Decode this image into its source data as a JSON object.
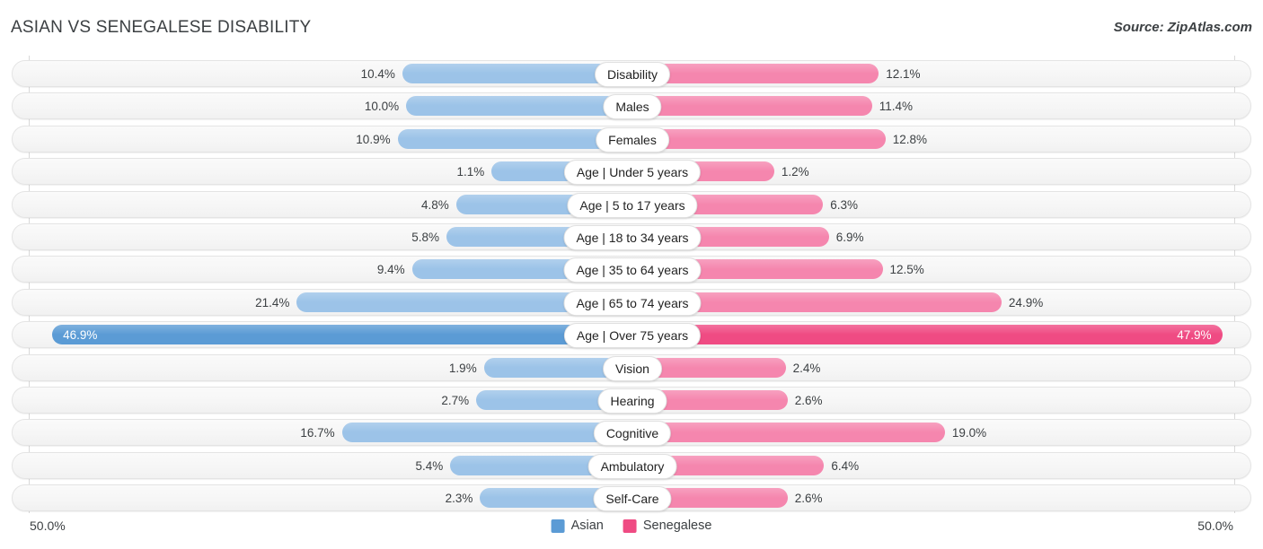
{
  "header": {
    "title": "ASIAN VS SENEGALESE DISABILITY",
    "source": "Source: ZipAtlas.com"
  },
  "footer": {
    "axis_min": "50.0%",
    "axis_max": "50.0%",
    "legend": [
      {
        "label": "Asian",
        "color": "#5b9bd5",
        "swatch": "asian"
      },
      {
        "label": "Senegalese",
        "color": "#ef4b83",
        "swatch": "senegalese"
      }
    ]
  },
  "colors": {
    "asian_bar": "#9cc3e8",
    "senegalese_bar": "#f586ae",
    "asian_bar_emphasis": "#5b9bd5",
    "senegalese_bar_emphasis": "#ef4b83",
    "row_background": "#f6f6f6",
    "text": "#3c4043"
  },
  "chart_data": {
    "type": "bar",
    "title": "ASIAN VS SENEGALESE DISABILITY",
    "orientation": "horizontal-diverging",
    "xlabel": "",
    "ylabel": "",
    "xlim": [
      -50.0,
      50.0
    ],
    "axis_tick_labels": [
      "50.0%",
      "50.0%"
    ],
    "grid": true,
    "legend_position": "bottom-center",
    "units": "percent",
    "categories": [
      "Disability",
      "Males",
      "Females",
      "Age | Under 5 years",
      "Age | 5 to 17 years",
      "Age | 18 to 34 years",
      "Age | 35 to 64 years",
      "Age | 65 to 74 years",
      "Age | Over 75 years",
      "Vision",
      "Hearing",
      "Cognitive",
      "Ambulatory",
      "Self-Care"
    ],
    "series": [
      {
        "name": "Asian",
        "side": "left",
        "color": "#9cc3e8",
        "values": [
          10.4,
          10.0,
          10.9,
          1.1,
          4.8,
          5.8,
          9.4,
          21.4,
          46.9,
          1.9,
          2.7,
          16.7,
          5.4,
          2.3
        ],
        "labels": [
          "10.4%",
          "10.0%",
          "10.9%",
          "1.1%",
          "4.8%",
          "5.8%",
          "9.4%",
          "21.4%",
          "46.9%",
          "1.9%",
          "2.7%",
          "16.7%",
          "5.4%",
          "2.3%"
        ]
      },
      {
        "name": "Senegalese",
        "side": "right",
        "color": "#f586ae",
        "values": [
          12.1,
          11.4,
          12.8,
          1.2,
          6.3,
          6.9,
          12.5,
          24.9,
          47.9,
          2.4,
          2.6,
          19.0,
          6.4,
          2.6
        ],
        "labels": [
          "12.1%",
          "11.4%",
          "12.8%",
          "1.2%",
          "6.3%",
          "6.9%",
          "12.5%",
          "24.9%",
          "47.9%",
          "2.4%",
          "2.6%",
          "19.0%",
          "6.4%",
          "2.6%"
        ]
      }
    ],
    "rows": [
      {
        "label": "Disability",
        "left_value": 10.4,
        "left_label": "10.4%",
        "right_value": 12.1,
        "right_label": "12.1%",
        "emphasis": false
      },
      {
        "label": "Males",
        "left_value": 10.0,
        "left_label": "10.0%",
        "right_value": 11.4,
        "right_label": "11.4%",
        "emphasis": false
      },
      {
        "label": "Females",
        "left_value": 10.9,
        "left_label": "10.9%",
        "right_value": 12.8,
        "right_label": "12.8%",
        "emphasis": false
      },
      {
        "label": "Age | Under 5 years",
        "left_value": 1.1,
        "left_label": "1.1%",
        "right_value": 1.2,
        "right_label": "1.2%",
        "emphasis": false
      },
      {
        "label": "Age | 5 to 17 years",
        "left_value": 4.8,
        "left_label": "4.8%",
        "right_value": 6.3,
        "right_label": "6.3%",
        "emphasis": false
      },
      {
        "label": "Age | 18 to 34 years",
        "left_value": 5.8,
        "left_label": "5.8%",
        "right_value": 6.9,
        "right_label": "6.9%",
        "emphasis": false
      },
      {
        "label": "Age | 35 to 64 years",
        "left_value": 9.4,
        "left_label": "9.4%",
        "right_value": 12.5,
        "right_label": "12.5%",
        "emphasis": false
      },
      {
        "label": "Age | 65 to 74 years",
        "left_value": 21.4,
        "left_label": "21.4%",
        "right_value": 24.9,
        "right_label": "24.9%",
        "emphasis": false
      },
      {
        "label": "Age | Over 75 years",
        "left_value": 46.9,
        "left_label": "46.9%",
        "right_value": 47.9,
        "right_label": "47.9%",
        "emphasis": true
      },
      {
        "label": "Vision",
        "left_value": 1.9,
        "left_label": "1.9%",
        "right_value": 2.4,
        "right_label": "2.4%",
        "emphasis": false
      },
      {
        "label": "Hearing",
        "left_value": 2.7,
        "left_label": "2.7%",
        "right_value": 2.6,
        "right_label": "2.6%",
        "emphasis": false
      },
      {
        "label": "Cognitive",
        "left_value": 16.7,
        "left_label": "16.7%",
        "right_value": 19.0,
        "right_label": "19.0%",
        "emphasis": false
      },
      {
        "label": "Ambulatory",
        "left_value": 5.4,
        "left_label": "5.4%",
        "right_value": 6.4,
        "right_label": "6.4%",
        "emphasis": false
      },
      {
        "label": "Self-Care",
        "left_value": 2.3,
        "left_label": "2.3%",
        "right_value": 2.6,
        "right_label": "2.6%",
        "emphasis": false
      }
    ]
  }
}
